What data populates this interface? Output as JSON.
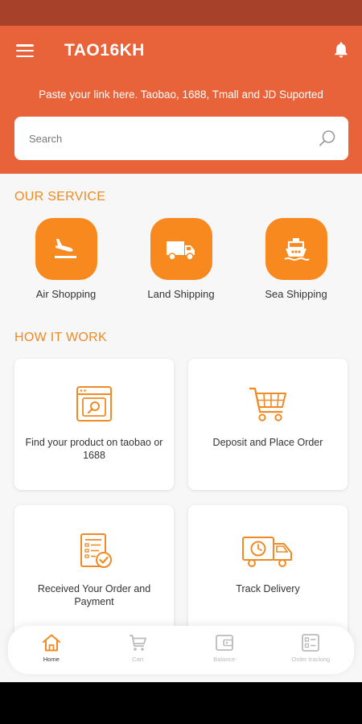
{
  "header": {
    "title": "TAO16KH",
    "subtitle": "Paste your link here. Taobao, 1688, Tmall and JD Suported"
  },
  "search": {
    "placeholder": "Search"
  },
  "services": {
    "title": "OUR SERVICE",
    "items": [
      {
        "label": "Air Shopping",
        "icon": "plane-landing-icon"
      },
      {
        "label": "Land Shipping",
        "icon": "truck-icon"
      },
      {
        "label": "Sea Shipping",
        "icon": "ship-icon"
      }
    ]
  },
  "how": {
    "title": "HOW IT WORK",
    "cards": [
      {
        "label": "Find your product on taobao or 1688",
        "icon": "browser-search-icon"
      },
      {
        "label": "Deposit and Place Order",
        "icon": "cart-icon"
      },
      {
        "label": "Received Your Order and Payment",
        "icon": "invoice-check-icon"
      },
      {
        "label": "Track Delivery",
        "icon": "delivery-truck-clock-icon"
      }
    ]
  },
  "nav": {
    "items": [
      {
        "label": "Home",
        "icon": "home-icon",
        "active": true
      },
      {
        "label": "Cart",
        "icon": "cart-icon",
        "active": false
      },
      {
        "label": "Balance",
        "icon": "wallet-icon",
        "active": false
      },
      {
        "label": "Order tracking",
        "icon": "order-list-icon",
        "active": false
      }
    ]
  },
  "colors": {
    "status_bar": "#A8412A",
    "header": "#E9633A",
    "accent": "#F7891F",
    "section_title": "#F08A24",
    "background": "#F7F7F7"
  }
}
